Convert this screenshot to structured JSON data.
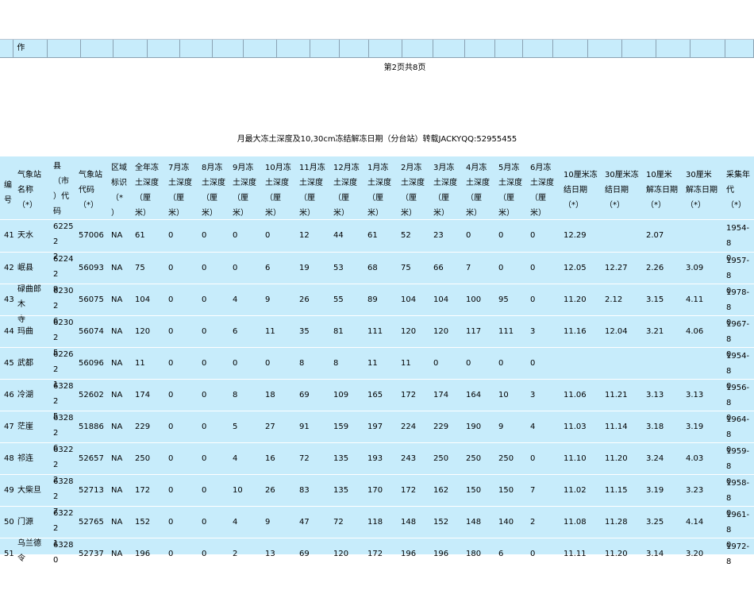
{
  "top_row": {
    "first_cell": "作"
  },
  "pager": "第2页共8页",
  "caption": "月最大冻土深度及10,30cm冻结解冻日期（分台站）转载JACKYQQ:52955455",
  "headers": {
    "no": "编\n号",
    "name": "气象站\n名称\n（*）",
    "county": "县\n（市\n）代\n码",
    "code": "气象站\n代码\n（*）",
    "region": "区域\n标识\n（*\n）",
    "annual": "全年冻\n土深度\n（厘\n米）",
    "jul": "7月冻\n土深度\n（厘\n米）",
    "aug": "8月冻\n土深度\n（厘\n米）",
    "sep": "9月冻\n土深度\n（厘\n米）",
    "oct": "10月冻\n土深度\n（厘\n米）",
    "nov": "11月冻\n土深度\n（厘\n米）",
    "dec": "12月冻\n土深度\n（厘\n米）",
    "jan": "1月冻\n土深度\n（厘\n米）",
    "feb": "2月冻\n土深度\n（厘\n米）",
    "mar": "3月冻\n土深度\n（厘\n米）",
    "apr": "4月冻\n土深度\n（厘\n米）",
    "may": "5月冻\n土深度\n（厘\n米）",
    "jun": "6月冻\n土深度\n（厘\n米）",
    "f10": "10厘米冻\n结日期\n（*）",
    "f30": "30厘米冻\n结日期\n（*）",
    "t10": "10厘米\n解冻日期\n（*）",
    "t30": "30厘米\n解冻日期\n（*）",
    "years": "采集年\n代\n（*）"
  },
  "rows": [
    {
      "no": "41",
      "name": "天水",
      "county": "6225\n2\n2",
      "code": "57006",
      "region": "NA",
      "annual": "61",
      "jul": "0",
      "aug": "0",
      "sep": "0",
      "oct": "0",
      "nov": "12",
      "dec": "44",
      "jan": "61",
      "feb": "52",
      "mar": "23",
      "apr": "0",
      "may": "0",
      "jun": "0",
      "f10": "12.29",
      "f30": "",
      "t10": "2.07",
      "t30": "",
      "years": "1954-8\n0"
    },
    {
      "no": "42",
      "name": "岷县",
      "county": "6224\n2\n9",
      "code": "56093",
      "region": "NA",
      "annual": "75",
      "jul": "0",
      "aug": "0",
      "sep": "0",
      "oct": "6",
      "nov": "19",
      "dec": "53",
      "jan": "68",
      "feb": "75",
      "mar": "66",
      "apr": "7",
      "may": "0",
      "jun": "0",
      "f10": "12.05",
      "f30": "12.27",
      "t10": "2.26",
      "t30": "3.09",
      "years": "1957-8\n0"
    },
    {
      "no": "43",
      "name": "碌曲郎\n木\n寺",
      "county": "6230\n2\n6",
      "code": "56075",
      "region": "NA",
      "annual": "104",
      "jul": "0",
      "aug": "0",
      "sep": "4",
      "oct": "9",
      "nov": "26",
      "dec": "55",
      "jan": "89",
      "feb": "104",
      "mar": "104",
      "apr": "100",
      "may": "95",
      "jun": "0",
      "f10": "11.20",
      "f30": "2.12",
      "t10": "3.15",
      "t30": "4.11",
      "years": "1978-8\n0"
    },
    {
      "no": "44",
      "name": "玛曲",
      "county": "6230\n2\n5",
      "code": "56074",
      "region": "NA",
      "annual": "120",
      "jul": "0",
      "aug": "0",
      "sep": "6",
      "oct": "11",
      "nov": "35",
      "dec": "81",
      "jan": "111",
      "feb": "120",
      "mar": "120",
      "apr": "117",
      "may": "111",
      "jun": "3",
      "f10": "11.16",
      "f30": "12.04",
      "t10": "3.21",
      "t30": "4.06",
      "years": "1967-8\n0"
    },
    {
      "no": "45",
      "name": "武都",
      "county": "6226\n2\n1",
      "code": "56096",
      "region": "NA",
      "annual": "11",
      "jul": "0",
      "aug": "0",
      "sep": "0",
      "oct": "0",
      "nov": "8",
      "dec": "8",
      "jan": "11",
      "feb": "11",
      "mar": "0",
      "apr": "0",
      "may": "0",
      "jun": "0",
      "f10": "",
      "f30": "",
      "t10": "",
      "t30": "",
      "years": "1954-8\n0"
    },
    {
      "no": "46",
      "name": "冷湖",
      "county": "6328\n2\n5",
      "code": "52602",
      "region": "NA",
      "annual": "174",
      "jul": "0",
      "aug": "0",
      "sep": "8",
      "oct": "18",
      "nov": "69",
      "dec": "109",
      "jan": "165",
      "feb": "172",
      "mar": "174",
      "apr": "164",
      "may": "10",
      "jun": "3",
      "f10": "11.06",
      "f30": "11.21",
      "t10": "3.13",
      "t30": "3.13",
      "years": "1956-8\n0"
    },
    {
      "no": "47",
      "name": "茫崖",
      "county": "6328\n2\n6",
      "code": "51886",
      "region": "NA",
      "annual": "229",
      "jul": "0",
      "aug": "0",
      "sep": "5",
      "oct": "27",
      "nov": "91",
      "dec": "159",
      "jan": "197",
      "feb": "224",
      "mar": "229",
      "apr": "190",
      "may": "9",
      "jun": "4",
      "f10": "11.03",
      "f30": "11.14",
      "t10": "3.18",
      "t30": "3.19",
      "years": "1964-8\n0"
    },
    {
      "no": "48",
      "name": "祁连",
      "county": "6322\n2\n2",
      "code": "52657",
      "region": "NA",
      "annual": "250",
      "jul": "0",
      "aug": "0",
      "sep": "4",
      "oct": "16",
      "nov": "72",
      "dec": "135",
      "jan": "193",
      "feb": "243",
      "mar": "250",
      "apr": "250",
      "may": "250",
      "jun": "0",
      "f10": "11.10",
      "f30": "11.20",
      "t10": "3.24",
      "t30": "4.03",
      "years": "1959-8\n0"
    },
    {
      "no": "49",
      "name": "大柴旦",
      "county": "6328\n2\n7",
      "code": "52713",
      "region": "NA",
      "annual": "172",
      "jul": "0",
      "aug": "0",
      "sep": "10",
      "oct": "26",
      "nov": "83",
      "dec": "135",
      "jan": "170",
      "feb": "172",
      "mar": "162",
      "apr": "150",
      "may": "150",
      "jun": "7",
      "f10": "11.02",
      "f30": "11.15",
      "t10": "3.19",
      "t30": "3.23",
      "years": "1958-8\n0"
    },
    {
      "no": "50",
      "name": "门源",
      "county": "6322\n2\n1",
      "code": "52765",
      "region": "NA",
      "annual": "152",
      "jul": "0",
      "aug": "0",
      "sep": "4",
      "oct": "9",
      "nov": "47",
      "dec": "72",
      "jan": "118",
      "feb": "148",
      "mar": "152",
      "apr": "148",
      "may": "140",
      "jun": "2",
      "f10": "11.08",
      "f30": "11.28",
      "t10": "3.25",
      "t30": "4.14",
      "years": "1961-8\n0"
    },
    {
      "no": "51",
      "name": "乌兰德\n令",
      "county": "6328\n0",
      "code": "52737",
      "region": "NA",
      "annual": "196",
      "jul": "0",
      "aug": "0",
      "sep": "2",
      "oct": "13",
      "nov": "69",
      "dec": "120",
      "jan": "172",
      "feb": "196",
      "mar": "196",
      "apr": "180",
      "may": "6",
      "jun": "0",
      "f10": "11.11",
      "f30": "11.20",
      "t10": "3.14",
      "t30": "3.20",
      "years": "1972-8"
    }
  ]
}
